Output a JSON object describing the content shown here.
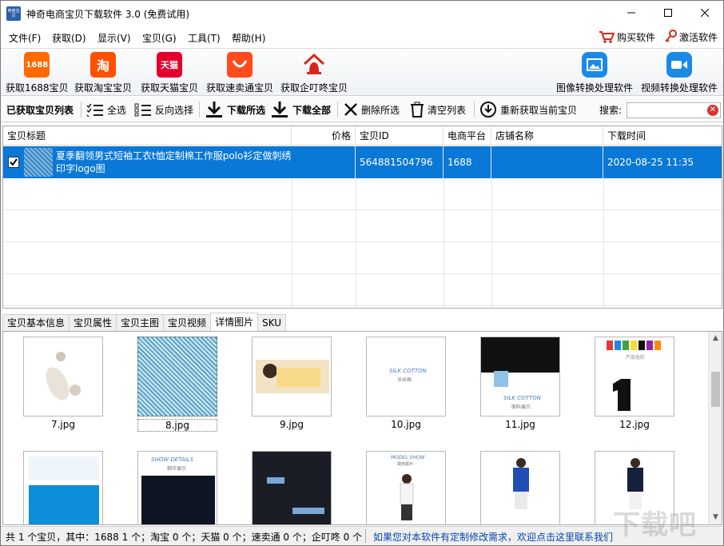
{
  "window": {
    "title": "神奇电商宝贝下载软件 3.0 (免费试用)",
    "app_icon_text": "电商宝贝"
  },
  "menu": {
    "items": [
      "文件(F)",
      "获取(D)",
      "显示(V)",
      "宝贝(G)",
      "工具(T)",
      "帮助(H)"
    ],
    "buy": "购买软件",
    "activate": "激活软件"
  },
  "toolbar": {
    "get_1688": "获取1688宝贝",
    "get_taobao": "获取淘宝宝贝",
    "get_tmall": "获取天猫宝贝",
    "get_sumaitong": "获取速卖通宝贝",
    "get_qidingdong": "获取企叮咚宝贝",
    "image_tool": "图像转换处理软件",
    "video_tool": "视频转换处理软件",
    "icon_1688": "1688",
    "icon_taobao": "淘",
    "icon_tmall": "天猫"
  },
  "actions": {
    "list_title": "已获取宝贝列表",
    "select_all": "全选",
    "invert": "反向选择",
    "download_selected": "下载所选",
    "download_all": "下载全部",
    "delete_selected": "删除所选",
    "clear_list": "清空列表",
    "refetch": "重新获取当前宝贝",
    "search_label": "搜索:"
  },
  "table": {
    "columns": [
      "宝贝标题",
      "价格",
      "宝贝ID",
      "电商平台",
      "店铺名称",
      "下载时间"
    ],
    "rows": [
      {
        "title": "夏季翻领男式短袖工衣t恤定制棉工作服polo衫定做刺绣印字logo图",
        "price": "",
        "id": "564881504796",
        "platform": "1688",
        "shop": "",
        "time": "2020-08-25 11:35",
        "checked": true
      }
    ]
  },
  "tabs": [
    "宝贝基本信息",
    "宝贝属性",
    "宝贝主图",
    "宝贝视频",
    "详情图片",
    "SKU"
  ],
  "active_tab": "详情图片",
  "images": {
    "row1": [
      "7.jpg",
      "8.jpg",
      "9.jpg",
      "10.jpg",
      "11.jpg",
      "12.jpg"
    ],
    "img10_text": "SILK COTTON",
    "img10_sub": "冰丝棉",
    "img11_text": "SILK COTTON",
    "img11_sub": "面料展示",
    "img12_text": "产品色彩",
    "img14_text": "SHOW DETAILS",
    "img14_sub": "细节展示",
    "img16_text": "MODEL SHOW",
    "img16_sub": "模特展示"
  },
  "status": {
    "summary": "共 1 个宝贝，其中：1688 1 个；淘宝 0 个；天猫 0 个；速卖通 0 个；企叮咚 0 个",
    "link": "如果您对本软件有定制修改需求，欢迎点击这里联系我们"
  },
  "watermark": "下载吧"
}
